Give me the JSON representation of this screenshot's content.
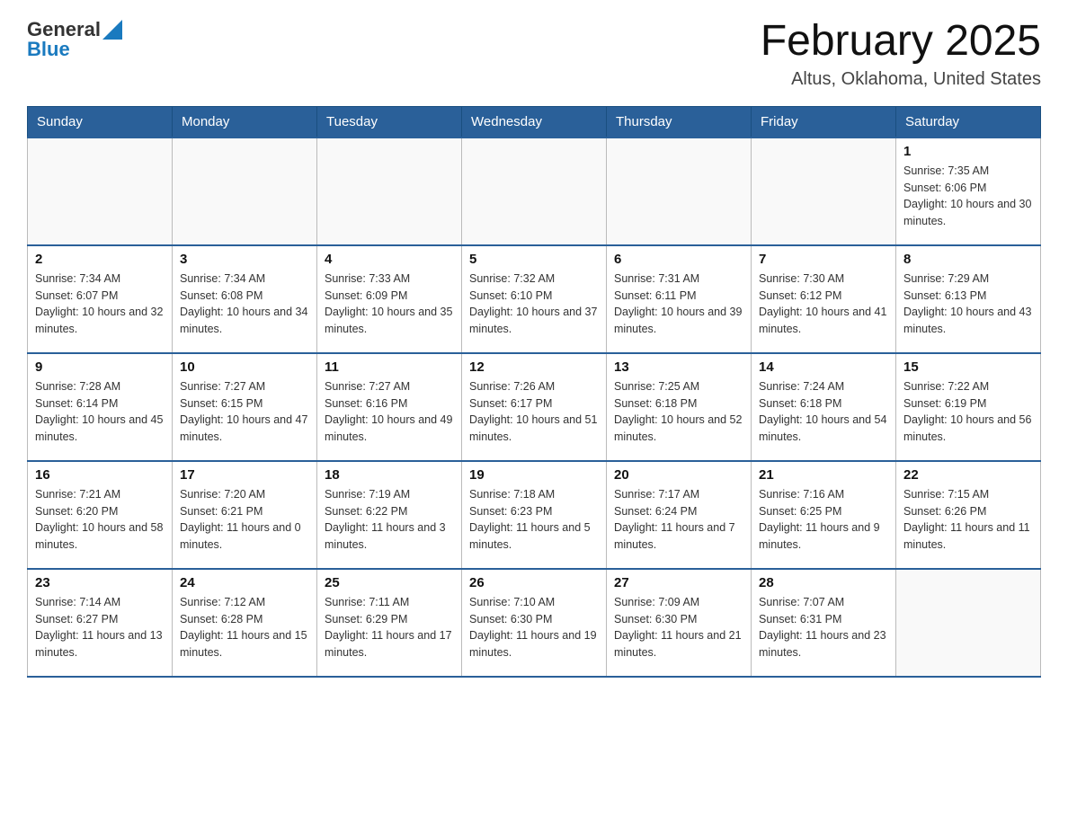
{
  "header": {
    "logo_general": "General",
    "logo_blue": "Blue",
    "month_title": "February 2025",
    "location": "Altus, Oklahoma, United States"
  },
  "days_of_week": [
    "Sunday",
    "Monday",
    "Tuesday",
    "Wednesday",
    "Thursday",
    "Friday",
    "Saturday"
  ],
  "weeks": [
    [
      {
        "day": "",
        "info": ""
      },
      {
        "day": "",
        "info": ""
      },
      {
        "day": "",
        "info": ""
      },
      {
        "day": "",
        "info": ""
      },
      {
        "day": "",
        "info": ""
      },
      {
        "day": "",
        "info": ""
      },
      {
        "day": "1",
        "info": "Sunrise: 7:35 AM\nSunset: 6:06 PM\nDaylight: 10 hours and 30 minutes."
      }
    ],
    [
      {
        "day": "2",
        "info": "Sunrise: 7:34 AM\nSunset: 6:07 PM\nDaylight: 10 hours and 32 minutes."
      },
      {
        "day": "3",
        "info": "Sunrise: 7:34 AM\nSunset: 6:08 PM\nDaylight: 10 hours and 34 minutes."
      },
      {
        "day": "4",
        "info": "Sunrise: 7:33 AM\nSunset: 6:09 PM\nDaylight: 10 hours and 35 minutes."
      },
      {
        "day": "5",
        "info": "Sunrise: 7:32 AM\nSunset: 6:10 PM\nDaylight: 10 hours and 37 minutes."
      },
      {
        "day": "6",
        "info": "Sunrise: 7:31 AM\nSunset: 6:11 PM\nDaylight: 10 hours and 39 minutes."
      },
      {
        "day": "7",
        "info": "Sunrise: 7:30 AM\nSunset: 6:12 PM\nDaylight: 10 hours and 41 minutes."
      },
      {
        "day": "8",
        "info": "Sunrise: 7:29 AM\nSunset: 6:13 PM\nDaylight: 10 hours and 43 minutes."
      }
    ],
    [
      {
        "day": "9",
        "info": "Sunrise: 7:28 AM\nSunset: 6:14 PM\nDaylight: 10 hours and 45 minutes."
      },
      {
        "day": "10",
        "info": "Sunrise: 7:27 AM\nSunset: 6:15 PM\nDaylight: 10 hours and 47 minutes."
      },
      {
        "day": "11",
        "info": "Sunrise: 7:27 AM\nSunset: 6:16 PM\nDaylight: 10 hours and 49 minutes."
      },
      {
        "day": "12",
        "info": "Sunrise: 7:26 AM\nSunset: 6:17 PM\nDaylight: 10 hours and 51 minutes."
      },
      {
        "day": "13",
        "info": "Sunrise: 7:25 AM\nSunset: 6:18 PM\nDaylight: 10 hours and 52 minutes."
      },
      {
        "day": "14",
        "info": "Sunrise: 7:24 AM\nSunset: 6:18 PM\nDaylight: 10 hours and 54 minutes."
      },
      {
        "day": "15",
        "info": "Sunrise: 7:22 AM\nSunset: 6:19 PM\nDaylight: 10 hours and 56 minutes."
      }
    ],
    [
      {
        "day": "16",
        "info": "Sunrise: 7:21 AM\nSunset: 6:20 PM\nDaylight: 10 hours and 58 minutes."
      },
      {
        "day": "17",
        "info": "Sunrise: 7:20 AM\nSunset: 6:21 PM\nDaylight: 11 hours and 0 minutes."
      },
      {
        "day": "18",
        "info": "Sunrise: 7:19 AM\nSunset: 6:22 PM\nDaylight: 11 hours and 3 minutes."
      },
      {
        "day": "19",
        "info": "Sunrise: 7:18 AM\nSunset: 6:23 PM\nDaylight: 11 hours and 5 minutes."
      },
      {
        "day": "20",
        "info": "Sunrise: 7:17 AM\nSunset: 6:24 PM\nDaylight: 11 hours and 7 minutes."
      },
      {
        "day": "21",
        "info": "Sunrise: 7:16 AM\nSunset: 6:25 PM\nDaylight: 11 hours and 9 minutes."
      },
      {
        "day": "22",
        "info": "Sunrise: 7:15 AM\nSunset: 6:26 PM\nDaylight: 11 hours and 11 minutes."
      }
    ],
    [
      {
        "day": "23",
        "info": "Sunrise: 7:14 AM\nSunset: 6:27 PM\nDaylight: 11 hours and 13 minutes."
      },
      {
        "day": "24",
        "info": "Sunrise: 7:12 AM\nSunset: 6:28 PM\nDaylight: 11 hours and 15 minutes."
      },
      {
        "day": "25",
        "info": "Sunrise: 7:11 AM\nSunset: 6:29 PM\nDaylight: 11 hours and 17 minutes."
      },
      {
        "day": "26",
        "info": "Sunrise: 7:10 AM\nSunset: 6:30 PM\nDaylight: 11 hours and 19 minutes."
      },
      {
        "day": "27",
        "info": "Sunrise: 7:09 AM\nSunset: 6:30 PM\nDaylight: 11 hours and 21 minutes."
      },
      {
        "day": "28",
        "info": "Sunrise: 7:07 AM\nSunset: 6:31 PM\nDaylight: 11 hours and 23 minutes."
      },
      {
        "day": "",
        "info": ""
      }
    ]
  ]
}
